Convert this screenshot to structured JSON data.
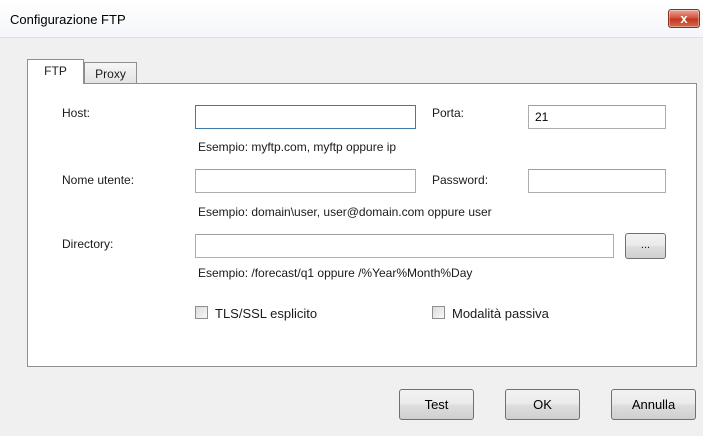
{
  "window": {
    "title": "Configurazione FTP",
    "close_label": "x"
  },
  "tabs": [
    {
      "label": "FTP",
      "selected": true
    },
    {
      "label": "Proxy",
      "selected": false
    }
  ],
  "form": {
    "host": {
      "label": "Host:",
      "value": "",
      "hint": "Esempio: myftp.com, myftp oppure ip"
    },
    "port": {
      "label": "Porta:",
      "value": "21"
    },
    "username": {
      "label": "Nome utente:",
      "value": "",
      "hint": "Esempio: domain\\user, user@domain.com oppure user"
    },
    "password": {
      "label": "Password:",
      "value": ""
    },
    "directory": {
      "label": "Directory:",
      "value": "",
      "hint": "Esempio: /forecast/q1 oppure /%Year%Month%Day",
      "browse_label": "..."
    },
    "tls": {
      "label": "TLS/SSL esplicito",
      "checked": false
    },
    "passive": {
      "label": "Modalità passiva",
      "checked": false
    }
  },
  "buttons": {
    "test": "Test",
    "ok": "OK",
    "cancel": "Annulla"
  }
}
